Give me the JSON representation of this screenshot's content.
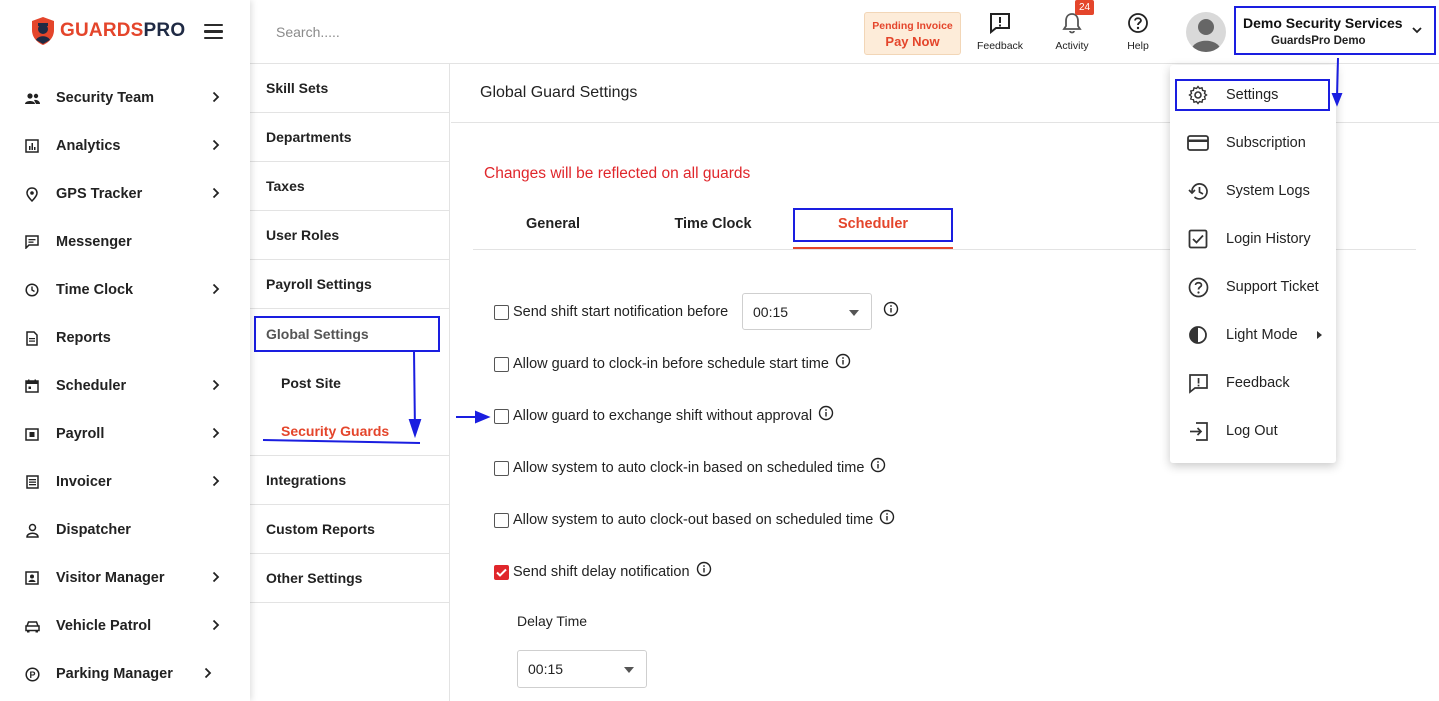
{
  "brand": {
    "part1": "GUARDS",
    "part2": "PRO"
  },
  "sidebar": {
    "items": [
      {
        "label": "Security Team",
        "icon": "team-icon",
        "has_chevron": true
      },
      {
        "label": "Analytics",
        "icon": "analytics-icon",
        "has_chevron": true
      },
      {
        "label": "GPS Tracker",
        "icon": "location-pin-icon",
        "has_chevron": true
      },
      {
        "label": "Messenger",
        "icon": "message-icon",
        "has_chevron": false
      },
      {
        "label": "Time Clock",
        "icon": "clock-icon",
        "has_chevron": true
      },
      {
        "label": "Reports",
        "icon": "document-icon",
        "has_chevron": false
      },
      {
        "label": "Scheduler",
        "icon": "calendar-icon",
        "has_chevron": true
      },
      {
        "label": "Payroll",
        "icon": "payroll-icon",
        "has_chevron": true
      },
      {
        "label": "Invoicer",
        "icon": "invoice-icon",
        "has_chevron": true
      },
      {
        "label": "Dispatcher",
        "icon": "dispatcher-icon",
        "has_chevron": false
      },
      {
        "label": "Visitor Manager",
        "icon": "visitor-icon",
        "has_chevron": true
      },
      {
        "label": "Vehicle Patrol",
        "icon": "car-icon",
        "has_chevron": true
      },
      {
        "label": "Parking Manager",
        "icon": "parking-icon",
        "has_chevron": true
      }
    ]
  },
  "topbar": {
    "search_placeholder": "Search.....",
    "pending": {
      "line1": "Pending Invoice",
      "line2": "Pay Now"
    },
    "feedback_label": "Feedback",
    "activity_label": "Activity",
    "activity_count": "24",
    "help_label": "Help",
    "account_name": "Demo Security Services",
    "account_sub": "GuardsPro Demo"
  },
  "settings_menu": {
    "items_top": [
      "Skill Sets",
      "Departments",
      "Taxes",
      "User Roles",
      "Payroll Settings"
    ],
    "global": "Global Settings",
    "global_sub": [
      "Post Site",
      "Security Guards"
    ],
    "items_bottom": [
      "Integrations",
      "Custom Reports",
      "Other Settings"
    ]
  },
  "main": {
    "title": "Global Guard Settings",
    "warning": "Changes will be reflected on all guards",
    "tabs": [
      "General",
      "Time Clock",
      "Scheduler"
    ],
    "active_tab": "Scheduler",
    "options": [
      {
        "label": "Send shift start notification before",
        "checked": false
      },
      {
        "label": "Allow guard to clock-in before schedule start time",
        "checked": false
      },
      {
        "label": "Allow guard to exchange shift without approval",
        "checked": false
      },
      {
        "label": "Allow system to auto clock-in based on scheduled time",
        "checked": false
      },
      {
        "label": "Allow system to auto clock-out based on scheduled time",
        "checked": false
      },
      {
        "label": "Send shift delay notification",
        "checked": true
      }
    ],
    "start_notification_value": "00:15",
    "delay_label": "Delay Time",
    "delay_value": "00:15"
  },
  "dropdown": {
    "items": [
      {
        "label": "Settings",
        "icon": "gear-icon"
      },
      {
        "label": "Subscription",
        "icon": "card-icon"
      },
      {
        "label": "System Logs",
        "icon": "history-icon"
      },
      {
        "label": "Login History",
        "icon": "checkbox-icon"
      },
      {
        "label": "Support Ticket",
        "icon": "help-circle-icon"
      },
      {
        "label": "Light Mode",
        "icon": "contrast-icon"
      },
      {
        "label": "Feedback",
        "icon": "feedback-icon"
      },
      {
        "label": "Log Out",
        "icon": "logout-icon"
      }
    ]
  },
  "colors": {
    "accent": "#e4452b",
    "annotation": "#1a1ee0",
    "warning": "#e0262b"
  }
}
